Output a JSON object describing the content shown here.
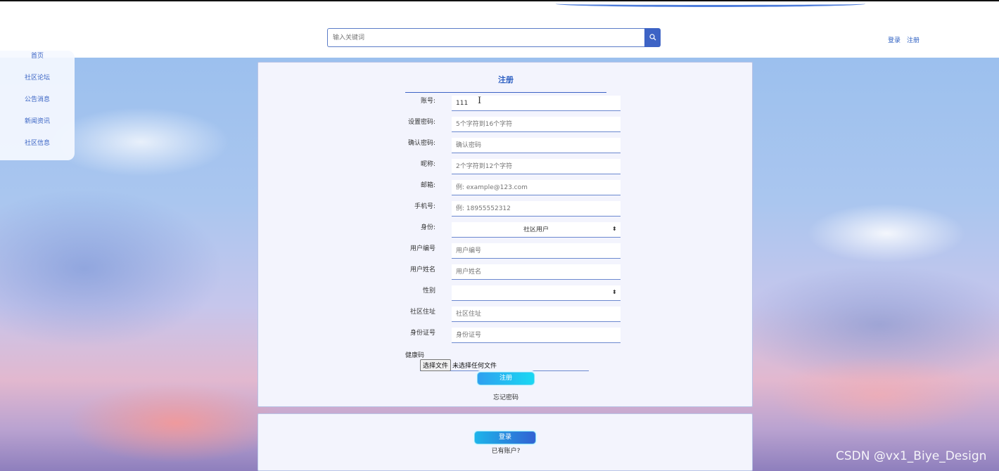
{
  "header": {
    "search_placeholder": "输入关键词",
    "login_link": "登录",
    "register_link": "注册"
  },
  "sidebar": {
    "items": [
      {
        "label": "首页"
      },
      {
        "label": "社区论坛"
      },
      {
        "label": "公告消息"
      },
      {
        "label": "新闻资讯"
      },
      {
        "label": "社区信息"
      }
    ]
  },
  "register_form": {
    "title": "注册",
    "fields": [
      {
        "label": "账号:",
        "value": "111",
        "placeholder": ""
      },
      {
        "label": "设置密码:",
        "value": "",
        "placeholder": "5个字符到16个字符"
      },
      {
        "label": "确认密码:",
        "value": "",
        "placeholder": "确认密码"
      },
      {
        "label": "昵称:",
        "value": "",
        "placeholder": "2个字符到12个字符"
      },
      {
        "label": "邮箱:",
        "value": "",
        "placeholder": "例: example@123.com"
      },
      {
        "label": "手机号:",
        "value": "",
        "placeholder": "例: 18955552312"
      },
      {
        "label": "身份:",
        "selected": "社区用户"
      },
      {
        "label": "用户编号",
        "value": "",
        "placeholder": "用户编号"
      },
      {
        "label": "用户姓名",
        "value": "",
        "placeholder": "用户姓名"
      },
      {
        "label": "性别",
        "selected": ""
      },
      {
        "label": "社区住址",
        "value": "",
        "placeholder": "社区住址"
      },
      {
        "label": "身份证号",
        "value": "",
        "placeholder": "身份证号"
      }
    ],
    "health_code_label": "健康码",
    "file_button": "选择文件",
    "file_status": "未选择任何文件",
    "submit_label": "注册",
    "forgot_password": "忘记密码"
  },
  "login_panel": {
    "login_label": "登录",
    "have_account": "已有账户?"
  },
  "watermark": "CSDN @vx1_Biye_Design",
  "colors": {
    "accent": "#3d63c5",
    "link": "#2d5fc2",
    "panel_bg": "#f3f4fd"
  }
}
